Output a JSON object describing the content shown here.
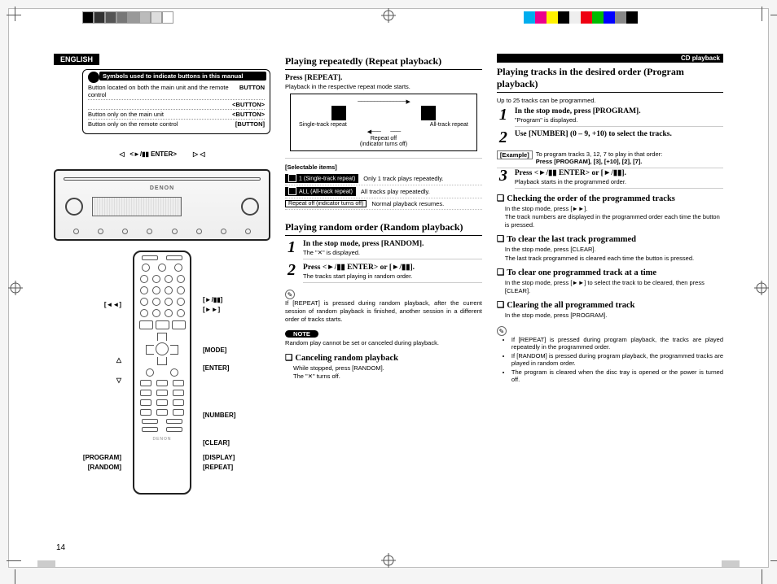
{
  "meta": {
    "language_tab": "ENGLISH",
    "section_tab": "CD playback",
    "page_number": "14"
  },
  "symbols_box": {
    "header": "Symbols used to indicate buttons in this manual",
    "rows": [
      {
        "l": "Button located on both the main unit and the remote control",
        "r": "BUTTON"
      },
      {
        "l": "",
        "r": "<BUTTON>"
      },
      {
        "l": "Button only on the main unit",
        "r": "<BUTTON>"
      },
      {
        "l": "Button only on the remote control",
        "r": "[BUTTON]"
      }
    ]
  },
  "device": {
    "top_label": "<►/▮▮ ENTER>",
    "brand": "DENON",
    "bottom_left": "◁",
    "bottom_right": "▷"
  },
  "remote_labels": {
    "top_l": "[◄◄]",
    "top_r1": "[►/▮▮]",
    "top_r2": "[►►]",
    "mode": "[MODE]",
    "enter": "[ENTER]",
    "nav_l_up": "△",
    "nav_l_dn": "▽",
    "number": "[NUMBER]",
    "clear": "[CLEAR]",
    "program": "[PROGRAM]",
    "random": "[RANDOM]",
    "display": "[DISPLAY]",
    "repeat": "[REPEAT]"
  },
  "repeat": {
    "heading": "Playing repeatedly (Repeat playback)",
    "press_line": "Press [REPEAT].",
    "press_sub": "Playback in the respective repeat mode starts.",
    "diagram": {
      "single": "Single-track repeat",
      "all": "All-track repeat",
      "off1": "Repeat off",
      "off2": "(indicator turns off)"
    },
    "selectable_header": "[Selectable items]",
    "items": [
      {
        "chip": "1 (Single-track repeat)",
        "desc": "Only 1 track plays repeatedly.",
        "inv": true
      },
      {
        "chip": "ALL (All-track repeat)",
        "desc": "All tracks play repeatedly.",
        "inv": true
      },
      {
        "chip": "Repeat off (indicator turns off)",
        "desc": "Normal playback resumes.",
        "inv": false
      }
    ]
  },
  "random": {
    "heading": "Playing random order (Random playback)",
    "step1": {
      "line1": "In the stop mode, press [RANDOM].",
      "line2": "The \"✕\" is displayed."
    },
    "step2": {
      "line1": "Press <►/▮▮ ENTER> or [►/▮▮].",
      "line2": "The tracks start playing in random order."
    },
    "note_text": "If [REPEAT] is pressed during random playback, after the current session of random playback is finished, another session in a different order of tracks starts.",
    "note_badge": "NOTE",
    "note2": "Random play cannot be set or canceled during playback.",
    "cancel_head": "Canceling random playback",
    "cancel_l1": "While stopped, press [RANDOM].",
    "cancel_l2": "The \"✕\" turns off."
  },
  "program": {
    "heading": "Playing tracks in the desired order (Program playback)",
    "intro": "Up to 25 tracks can be programmed.",
    "step1": {
      "line1": "In the stop mode, press [PROGRAM].",
      "line2": "\"Program\" is displayed."
    },
    "step2": {
      "line1": "Use [NUMBER] (0 – 9, +10) to select the tracks."
    },
    "example_label": "[Example]",
    "example_body1": "To program tracks 3, 12, 7 to play in that order:",
    "example_body2": "Press [PROGRAM], [3], [+10], [2], [7].",
    "step3": {
      "line1": "Press <►/▮▮ ENTER> or [►/▮▮].",
      "line2": "Playback starts in the programmed order."
    },
    "check_head": "Checking the order of the programmed tracks",
    "check_l1": "In the stop mode, press [►►].",
    "check_l2": "The track numbers are displayed in the programmed order each time the button is pressed.",
    "clear_last_head": "To clear the last track programmed",
    "clear_last_l1": "In the stop mode, press [CLEAR].",
    "clear_last_l2": "The last track programmed is cleared each time the button is pressed.",
    "clear_one_head": "To clear one programmed track at a time",
    "clear_one_l1": "In the stop mode, press [►►] to select the track to be cleared, then press [CLEAR].",
    "clear_all_head": "Clearing the all programmed track",
    "clear_all_l1": "In the stop mode, press [PROGRAM].",
    "bullets": [
      "If [REPEAT] is pressed during program playback, the tracks are played repeatedly in the programmed order.",
      "If [RANDOM] is pressed during program playback, the programmed tracks are played in random order.",
      "The program is cleared when the disc tray is opened or the power is turned off."
    ]
  },
  "colorbar": [
    "#000",
    "#333",
    "#555",
    "#777",
    "#999",
    "#bbb",
    "#ddd",
    "#fff"
  ],
  "colorbar2": [
    "#00adee",
    "#ec008b",
    "#fff100",
    "#000",
    "#eee",
    "#e01",
    "#0b0",
    "#00f",
    "#888",
    "#000"
  ]
}
